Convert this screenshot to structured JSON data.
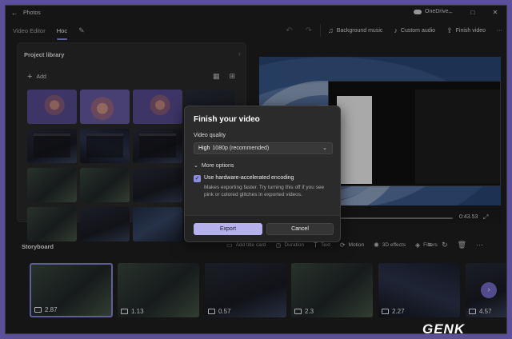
{
  "titlebar": {
    "back_icon": "←",
    "app_name": "Photos",
    "onedrive_label": "OneDrive",
    "controls": [
      "–",
      "□",
      "✕"
    ]
  },
  "toolbar": {
    "crumb_editor": "Video Editor",
    "crumb_project": "Hoc",
    "background_music": "Background music",
    "custom_audio": "Custom audio",
    "finish_video": "Finish video"
  },
  "library": {
    "title": "Project library",
    "add_label": "Add"
  },
  "preview": {
    "time": "0:43.53"
  },
  "storyboard": {
    "title": "Storyboard",
    "tools": [
      "Add title card",
      "Duration",
      "Text",
      "Motion",
      "3D effects",
      "Filters"
    ],
    "clips": [
      {
        "duration": "2.87"
      },
      {
        "duration": "1.13"
      },
      {
        "duration": "0.57"
      },
      {
        "duration": "2.3"
      },
      {
        "duration": "2.27"
      },
      {
        "duration": "4.57"
      }
    ]
  },
  "dialog": {
    "title": "Finish your video",
    "quality_label": "Video quality",
    "quality_value_bold": "High",
    "quality_value": "1080p (recommended)",
    "more_options": "More options",
    "hw_label": "Use hardware-accelerated encoding",
    "hw_desc": "Makes exporting faster. Try turning this off if you see pink or colored glitches in exported videos.",
    "export": "Export",
    "cancel": "Cancel"
  },
  "watermark": {
    "text": "GENK"
  },
  "colors": {
    "accent": "#8b8be0",
    "export_button": "#b6b0ec",
    "window_bg": "#202020"
  }
}
